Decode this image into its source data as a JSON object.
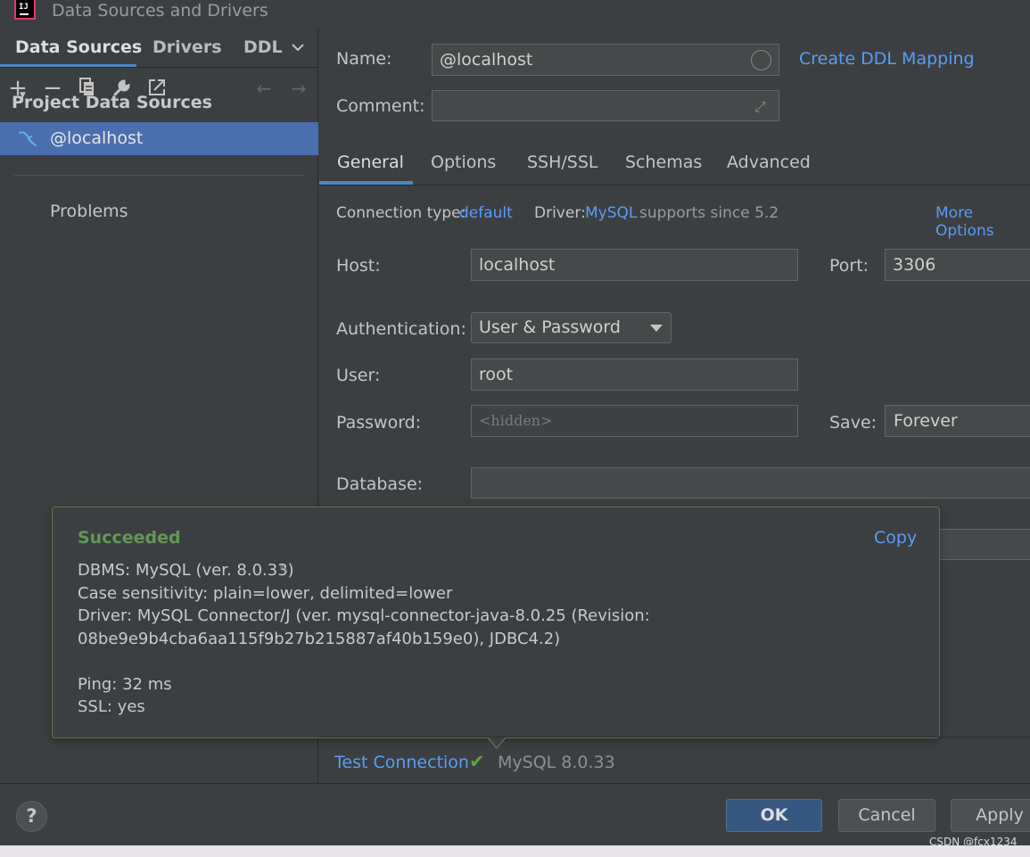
{
  "window": {
    "title": "Data Sources and Drivers",
    "logo_text": "IJ"
  },
  "left": {
    "tabs": [
      "Data Sources",
      "Drivers",
      "DDL"
    ],
    "section_title": "Project Data Sources",
    "data_source": "@localhost",
    "problems": "Problems"
  },
  "form": {
    "name_label": "Name:",
    "name_value": "@localhost",
    "ddl_link": "Create DDL Mapping",
    "comment_label": "Comment:",
    "comment_value": "",
    "tabs": [
      "General",
      "Options",
      "SSH/SSL",
      "Schemas",
      "Advanced"
    ],
    "connection_type_label": "Connection type:",
    "connection_type_value": "default",
    "driver_label": "Driver:",
    "driver_value": "MySQL",
    "driver_note": "supports since 5.2",
    "more_options": "More Options",
    "host_label": "Host:",
    "host_value": "localhost",
    "port_label": "Port:",
    "port_value": "3306",
    "auth_label": "Authentication:",
    "auth_value": "User & Password",
    "user_label": "User:",
    "user_value": "root",
    "password_label": "Password:",
    "password_placeholder": "<hidden>",
    "save_label": "Save:",
    "save_value": "Forever",
    "database_label": "Database:",
    "database_value": ""
  },
  "popup": {
    "title": "Succeeded",
    "copy": "Copy",
    "lines": [
      "DBMS: MySQL (ver. 8.0.33)",
      "Case sensitivity: plain=lower, delimited=lower",
      "Driver: MySQL Connector/J (ver. mysql-connector-java-8.0.25 (Revision:",
      "08be9e9b4cba6aa115f9b27b215887af40b159e0), JDBC4.2)",
      "Ping: 32 ms",
      "SSL: yes"
    ]
  },
  "test": {
    "link": "Test Connection",
    "result": "MySQL 8.0.33"
  },
  "footer": {
    "help": "?",
    "ok": "OK",
    "cancel": "Cancel",
    "apply": "Apply"
  },
  "watermark": "CSDN @fcx1234",
  "colors": {
    "accent": "#4a88c7",
    "link": "#589df6",
    "selection": "#4b6eaf",
    "success": "#629755"
  }
}
